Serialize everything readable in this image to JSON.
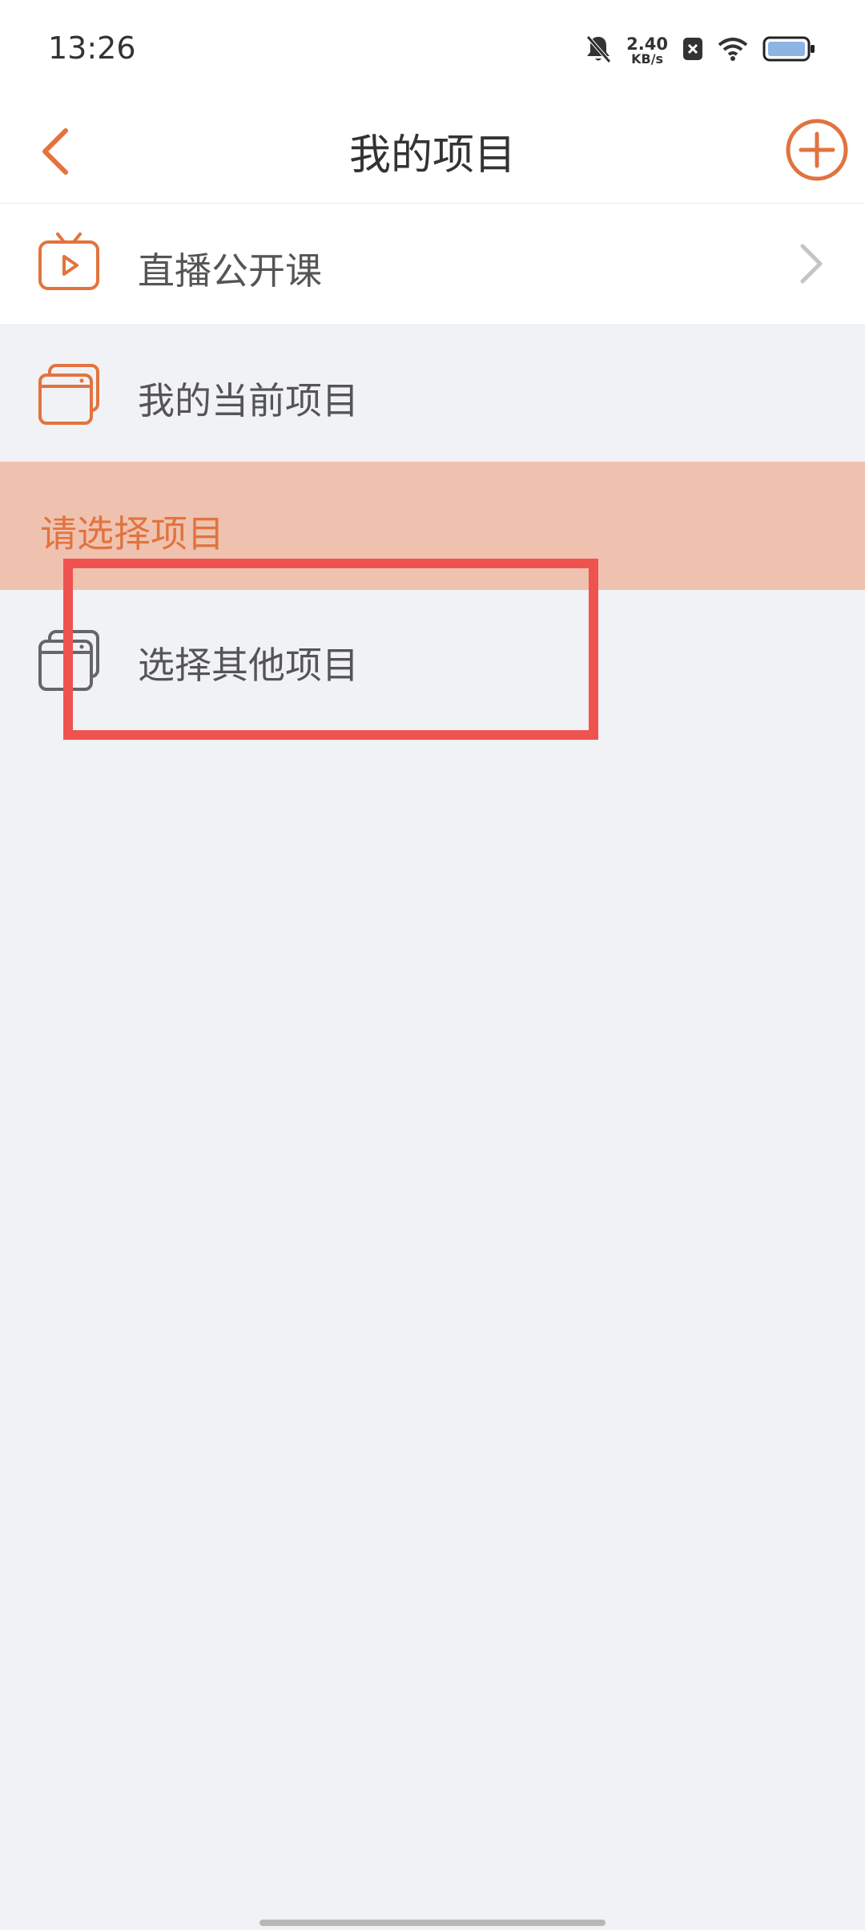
{
  "status_bar": {
    "time": "13:26",
    "net_speed_value": "2.40",
    "net_speed_unit": "KB/s",
    "icons": [
      "bell-off-icon",
      "close-box-icon",
      "wifi-icon",
      "battery-icon"
    ]
  },
  "header": {
    "title": "我的项目",
    "back_icon": "chevron-left-icon",
    "add_icon": "plus-circle-icon"
  },
  "rows": {
    "live": {
      "label": "直播公开课",
      "icon": "tv-play-icon"
    },
    "current": {
      "label": "我的当前项目",
      "icon": "stacked-cards-icon"
    },
    "section_title": "请选择项目",
    "other": {
      "label": "选择其他项目",
      "icon": "stacked-cards-icon"
    }
  },
  "colors": {
    "accent": "#e2733f",
    "section_bg": "#efc2b0",
    "page_bg": "#f0f2f5",
    "highlight": "#ef5350"
  }
}
